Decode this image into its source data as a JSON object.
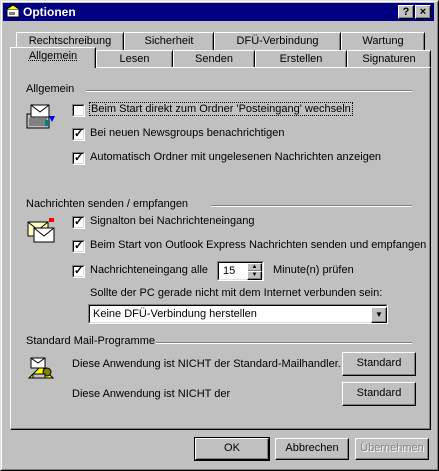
{
  "window": {
    "title": "Optionen",
    "help_label": "?",
    "close_label": "×"
  },
  "tabs_row1": [
    {
      "label": "Rechtschreibung"
    },
    {
      "label": "Sicherheit"
    },
    {
      "label": "DFÜ-Verbindung"
    },
    {
      "label": "Wartung"
    }
  ],
  "tabs_row2": [
    {
      "label": "Allgemein",
      "active": true
    },
    {
      "label": "Lesen"
    },
    {
      "label": "Senden"
    },
    {
      "label": "Erstellen"
    },
    {
      "label": "Signaturen"
    }
  ],
  "allgemein": {
    "title": "Allgemein",
    "icon": "inbox-icon",
    "options": [
      {
        "label": "Beim Start direkt zum Ordner 'Posteingang' wechseln",
        "checked": false,
        "focused": true
      },
      {
        "label": "Bei neuen Newsgroups benachrichtigen",
        "checked": true
      },
      {
        "label": "Automatisch Ordner mit ungelesenen Nachrichten anzeigen",
        "checked": true
      }
    ]
  },
  "senden": {
    "title": "Nachrichten senden / empfangen",
    "icon": "send-receive-icon",
    "options": [
      {
        "label": "Signalton bei Nachrichteneingang",
        "checked": true
      },
      {
        "label": "Beim Start von Outlook Express Nachrichten senden und empfangen",
        "checked": true
      },
      {
        "label": "Nachrichteneingang alle",
        "checked": true
      }
    ],
    "interval_value": "15",
    "interval_unit": "Minute(n) prüfen",
    "offline_prompt": "Sollte der PC gerade nicht mit dem Internet verbunden sein:",
    "offline_select": "Keine DFÜ-Verbindung herstellen"
  },
  "standard": {
    "title": "Standard Mail-Programme",
    "icon": "mail-programs-icon",
    "mail_text": "Diese Anwendung ist NICHT der Standard-Mailhandler.",
    "news_text": "Diese Anwendung ist NICHT der",
    "mail_button": "Standard",
    "news_button": "Standard"
  },
  "footer": {
    "ok": "OK",
    "cancel": "Abbrechen",
    "apply": "Übernehmen"
  }
}
